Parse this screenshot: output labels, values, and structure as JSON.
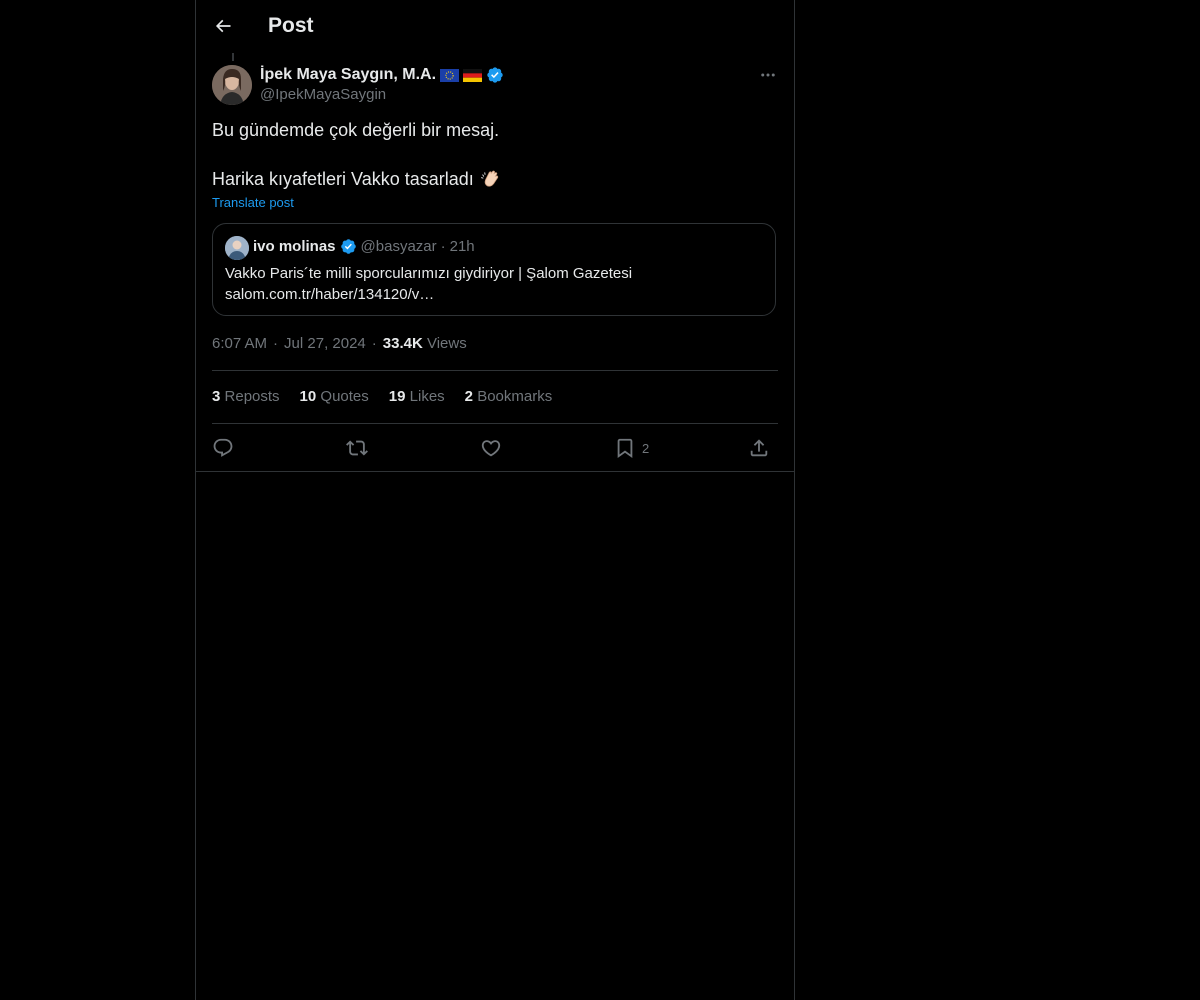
{
  "header": {
    "title": "Post"
  },
  "author": {
    "name": "İpek Maya Saygın, M.A.",
    "handle": "@IpekMayaSaygin"
  },
  "post": {
    "line1": "Bu gündemde çok değerli bir mesaj.",
    "line2": "Harika kıyafetleri Vakko tasarladı",
    "translate": "Translate post"
  },
  "quote": {
    "name": "ivo molinas",
    "handle": "@basyazar",
    "dot": "·",
    "time": "21h",
    "text": "Vakko Paris´te milli sporcularımızı giydiriyor | Şalom Gazetesi",
    "link": "salom.com.tr/haber/134120/v…"
  },
  "meta": {
    "time": "6:07 AM",
    "sep": "·",
    "date": "Jul 27, 2024",
    "views_count": "33.4K",
    "views_label": "Views"
  },
  "stats": {
    "reposts_count": "3",
    "reposts_label": "Reposts",
    "quotes_count": "10",
    "quotes_label": "Quotes",
    "likes_count": "19",
    "likes_label": "Likes",
    "bookmarks_count": "2",
    "bookmarks_label": "Bookmarks"
  },
  "actions": {
    "bookmark_count": "2"
  },
  "icons": [
    "back-arrow-icon",
    "verified-icon",
    "eu-flag-icon",
    "germany-flag-icon",
    "more-icon",
    "clap-icon",
    "reply-icon",
    "repost-icon",
    "like-icon",
    "bookmark-icon",
    "share-icon"
  ],
  "colors": {
    "accent": "#1d9bf0",
    "text": "#e7e9ea",
    "muted": "#71767b",
    "border": "#2f3336"
  }
}
